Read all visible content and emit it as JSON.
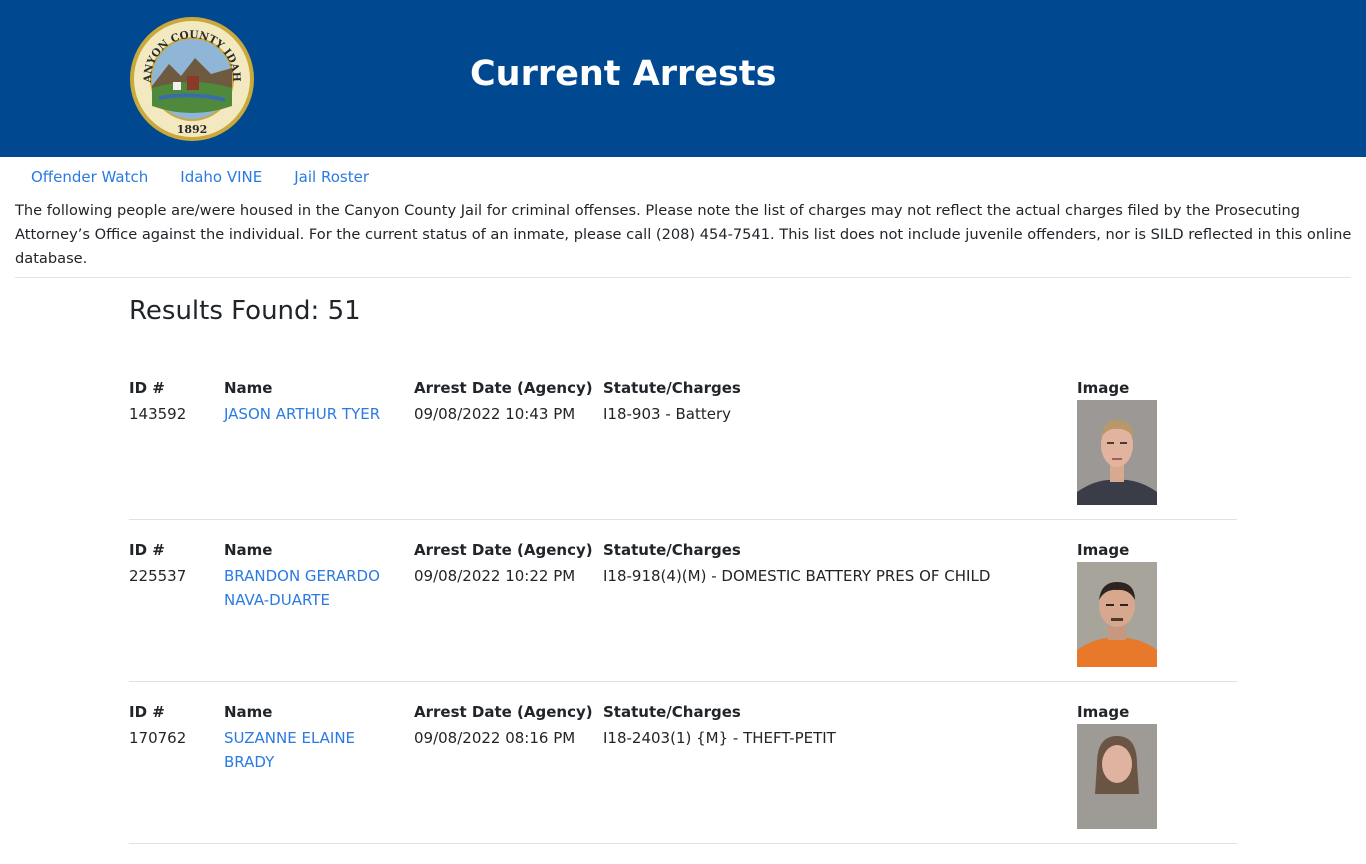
{
  "header": {
    "title": "Current Arrests",
    "seal": {
      "top_text": "CANYON COUNTY IDAHO",
      "year": "1892"
    },
    "background": "#004990"
  },
  "nav": {
    "links": [
      "Offender Watch",
      "Idaho VINE",
      "Jail Roster"
    ]
  },
  "intro": "The following people are/were housed in the Canyon County Jail for criminal offenses. Please note the list of charges may not reflect the actual charges filed by the Prosecuting Attorney’s Office against the individual. For the current status of an inmate, please call (208) 454-7541. This list does not include juvenile offenders, nor is SILD reflected in this online database.",
  "results": "Results Found: 51",
  "columns": {
    "id": "ID #",
    "name": "Name",
    "date": "Arrest Date (Agency)",
    "charges": "Statute/Charges",
    "image": "Image"
  },
  "records": [
    {
      "id": "143592",
      "name": "JASON ARTHUR TYER",
      "date": "09/08/2022 10:43 PM",
      "charges": "I18-903 - Battery",
      "shirt": "#3a3d48"
    },
    {
      "id": "225537",
      "name": "BRANDON GERARDO NAVA-DUARTE",
      "date": "09/08/2022 10:22 PM",
      "charges": "I18-918(4)(M) - DOMESTIC BATTERY PRES OF CHILD",
      "shirt": "#e8782a"
    },
    {
      "id": "170762",
      "name": "SUZANNE ELAINE BRADY",
      "date": "09/08/2022 08:16 PM",
      "charges": "I18-2403(1) {M} - THEFT-PETIT",
      "shirt": "#6a5a50"
    }
  ]
}
